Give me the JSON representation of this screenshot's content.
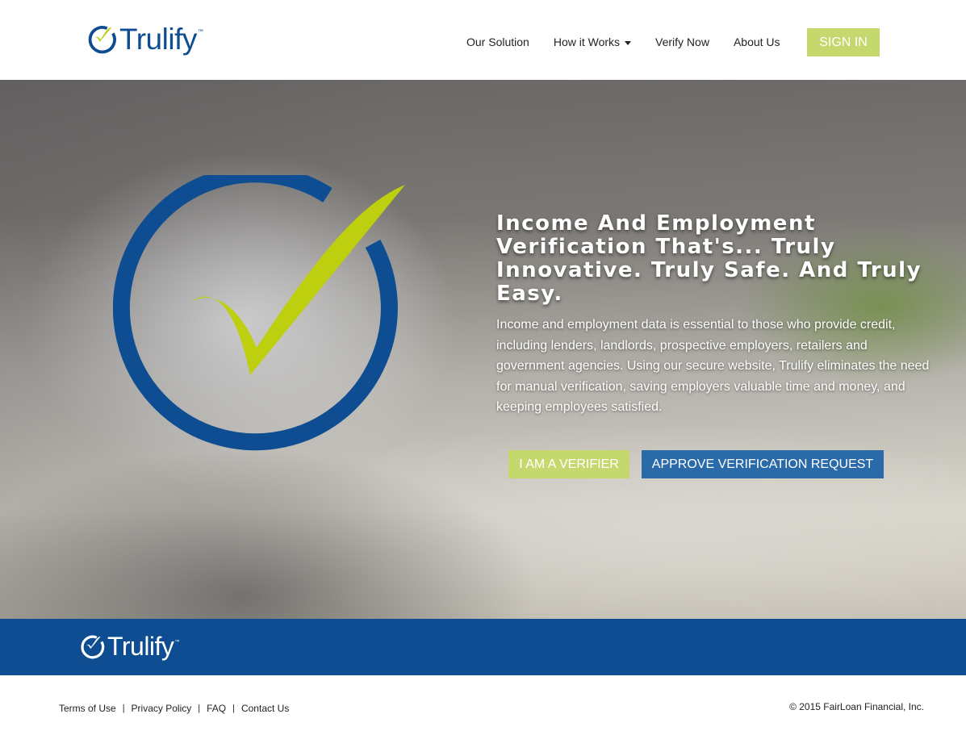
{
  "colors": {
    "brand_blue": "#0e4d92",
    "brand_green": "#c5d86d",
    "button_blue": "#2a6aa8"
  },
  "header": {
    "logo_text": "Trulify",
    "logo_tm": "™",
    "logo_icon": "check-circle-icon",
    "nav": {
      "our_solution": "Our Solution",
      "how_it_works": "How it Works",
      "verify_now": "Verify Now",
      "about_us": "About Us"
    },
    "sign_in": "SIGN IN"
  },
  "hero": {
    "title": "Income And Employment Verification That's... Truly Innovative. Truly Safe. And Truly Easy.",
    "body": "Income and employment data is essential to those who provide credit, including lenders, landlords, prospective employers, retailers and government agencies. Using our secure website, Trulify eliminates the need for manual verification, saving employers valuable time and money, and keeping employees satisfied.",
    "btn_verifier": "I AM A VERIFIER",
    "btn_approve": "APPROVE VERIFICATION REQUEST",
    "graphic_icon": "check-circle-icon"
  },
  "band": {
    "logo_text": "Trulify",
    "logo_tm": "™"
  },
  "footer": {
    "links": {
      "terms": "Terms of Use",
      "privacy": "Privacy Policy",
      "faq": "FAQ",
      "contact": "Contact Us"
    },
    "separator": "|",
    "copyright": "© 2015 FairLoan Financial, Inc."
  }
}
